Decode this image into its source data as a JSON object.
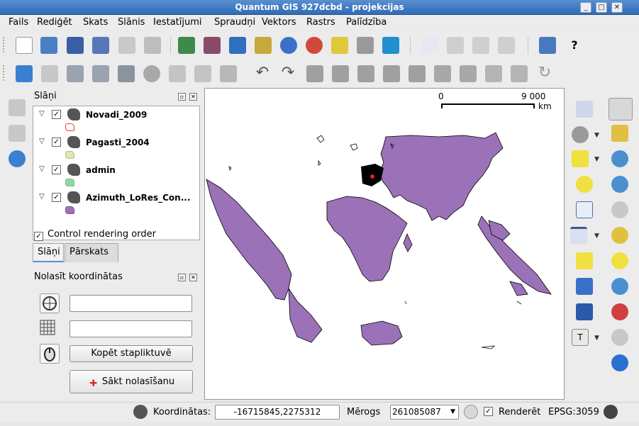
{
  "window": {
    "title": "Quantum GIS 927dcbd - projekcijas"
  },
  "menu": [
    "Fails",
    "Rediģēt",
    "Skats",
    "Slānis",
    "Iestatījumi",
    "Spraudņi",
    "Vektors",
    "Rastrs",
    "Palīdzība"
  ],
  "toolbar1": [
    "new-project-icon",
    "open-project-icon",
    "save-project-icon",
    "save-as-icon",
    "print-composer-icon",
    "print-icon",
    "add-vector-layer-icon",
    "add-raster-layer-icon",
    "add-postgis-layer-icon",
    "add-spatialite-layer-icon",
    "add-wms-layer-icon",
    "add-wfs-layer-icon",
    "new-vector-layer-icon",
    "remove-layer-icon",
    "toggle-overview-icon",
    "label-icon",
    "move-label-icon",
    "rotate-label-icon",
    "change-label-icon",
    "help-contents-icon",
    "whats-this-icon"
  ],
  "toolbar2": [
    "toggle-editing-icon",
    "save-edits-icon",
    "capture-polygon-icon",
    "move-feature-icon",
    "node-tool-icon",
    "delete-selected-icon",
    "cut-features-icon",
    "copy-features-icon",
    "paste-features-icon",
    "undo-icon",
    "redo-icon",
    "simplify-feature-icon",
    "add-ring-icon",
    "add-part-icon",
    "delete-ring-icon",
    "delete-part-icon",
    "reshape-features-icon",
    "split-features-icon",
    "merge-features-icon",
    "merge-attributes-icon",
    "rotate-point-symbols-icon"
  ],
  "layers_panel": {
    "title": "Slāņi",
    "layers": [
      {
        "name": "Novadi_2009",
        "swatch": "#ffffff",
        "outline": "#e04040"
      },
      {
        "name": "Pagasti_2004",
        "swatch": "#dfe6b4",
        "outline": "#b7c08a"
      },
      {
        "name": "admin",
        "swatch": "#8fd9a8",
        "outline": "#6fb98a"
      },
      {
        "name": "Azimuth_LoRes_Con...",
        "swatch": "#9b72b8",
        "outline": "#7a549a"
      }
    ],
    "control_rendering_label": "Control rendering order",
    "tabs": [
      "Slāņi",
      "Pārskats"
    ]
  },
  "coord_panel": {
    "title": "Nolasīt koordinātas",
    "copy_button": "Kopēt stapliktuvē",
    "start_button": "Sākt nolasīšanu"
  },
  "map": {
    "scalebar_start": "0",
    "scalebar_end": "9 000",
    "scalebar_unit": "km",
    "land_color": "#9b72b8"
  },
  "right_tools": [
    "identify-icon",
    "pan-icon",
    "settings-icon",
    "zoom-full-icon",
    "select-icon",
    "zoom-in-icon",
    "deselect-icon",
    "zoom-out-icon",
    "attribute-table-icon",
    "zoom-to-selection-icon",
    "measure-icon",
    "zoom-to-layer-icon",
    "annotation-icon",
    "zoom-actual-icon",
    "map-tips-icon",
    "zoom-last-icon",
    "home-icon",
    "zoom-back-icon",
    "text-annotation-icon",
    "zoom-next-icon",
    "refresh-icon"
  ],
  "status": {
    "coord_label": "Koordinātas:",
    "coord_value": "-16715845,2275312",
    "scale_label": "Mērogs",
    "scale_value": "261085087",
    "render_label": "Renderēt",
    "crs": "EPSG:3059"
  }
}
